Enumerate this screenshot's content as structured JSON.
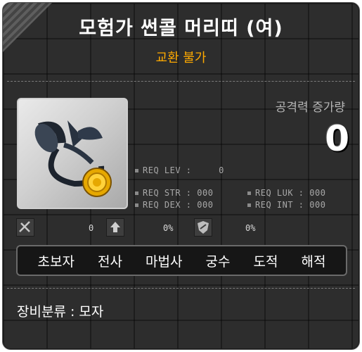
{
  "item": {
    "name": "모험가 썬콜 머리띠 (여)",
    "trade": "교환 불가"
  },
  "attack": {
    "label": "공격력 증가량",
    "value": "0"
  },
  "requirements": {
    "lev": "REQ LEV :     0",
    "str": "REQ STR : 000",
    "dex": "REQ DEX : 000",
    "luk": "REQ LUK : 000",
    "int": "REQ INT : 000"
  },
  "stats": {
    "value1": "0",
    "value2": "0%",
    "value3": "0%"
  },
  "jobs": [
    "초보자",
    "전사",
    "마법사",
    "궁수",
    "도적",
    "해적"
  ],
  "category": "장비분류 : 모자",
  "colors": {
    "title": "#ffffff",
    "trade": "#ffaa00",
    "background": "#2d2d2d"
  },
  "icons": [
    "item-icon",
    "cross-swords-icon",
    "upgrade-arrow-icon",
    "shield-icon"
  ]
}
